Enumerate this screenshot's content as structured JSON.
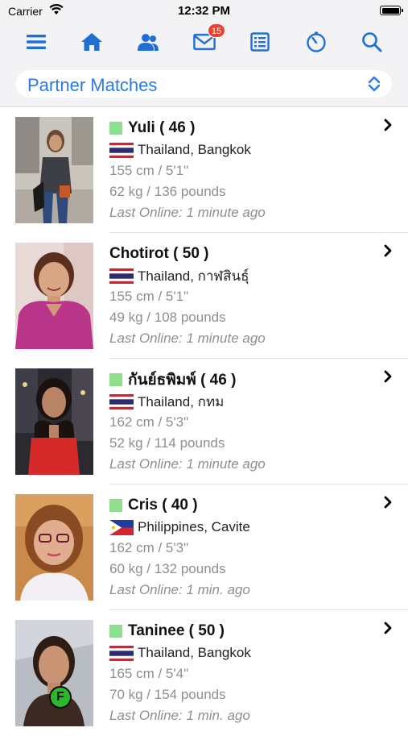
{
  "status_bar": {
    "carrier": "Carrier",
    "time": "12:32 PM"
  },
  "nav": {
    "icons": [
      "menu-icon",
      "home-icon",
      "users-icon",
      "mail-icon",
      "list-icon",
      "timer-icon",
      "search-icon"
    ],
    "mail_badge": "15",
    "accent_color": "#1f6fd6"
  },
  "selector": {
    "label": "Partner Matches"
  },
  "members": [
    {
      "name": "Yuli ( 46 )",
      "online": true,
      "flag": "thailand-flag",
      "location": "Thailand, Bangkok",
      "height": "155 cm / 5'1\"",
      "weight": "62 kg / 136 pounds",
      "last_online": "Last Online: 1 minute ago"
    },
    {
      "name": "Chotirot ( 50 )",
      "online": false,
      "flag": "thailand-flag",
      "location": "Thailand, กาฬสินธุ์",
      "height": "155 cm / 5'1\"",
      "weight": "49 kg / 108 pounds",
      "last_online": "Last Online: 1 minute ago"
    },
    {
      "name": "กันย์ธพิมพ์ ( 46 )",
      "online": true,
      "flag": "thailand-flag",
      "location": "Thailand, กทม",
      "height": "162 cm / 5'3\"",
      "weight": "52 kg / 114 pounds",
      "last_online": "Last Online: 1 minute ago"
    },
    {
      "name": "Cris ( 40 )",
      "online": true,
      "flag": "philippines-flag",
      "location": "Philippines, Cavite",
      "height": "162 cm / 5'3\"",
      "weight": "60 kg / 132 pounds",
      "last_online": "Last Online: 1 min. ago"
    },
    {
      "name": "Taninee ( 50 )",
      "online": true,
      "flag": "thailand-flag",
      "location": "Thailand, Bangkok",
      "height": "165 cm / 5'4\"",
      "weight": "70 kg / 154 pounds",
      "last_online": "Last Online: 1 min. ago",
      "photo_badge": "F"
    }
  ]
}
